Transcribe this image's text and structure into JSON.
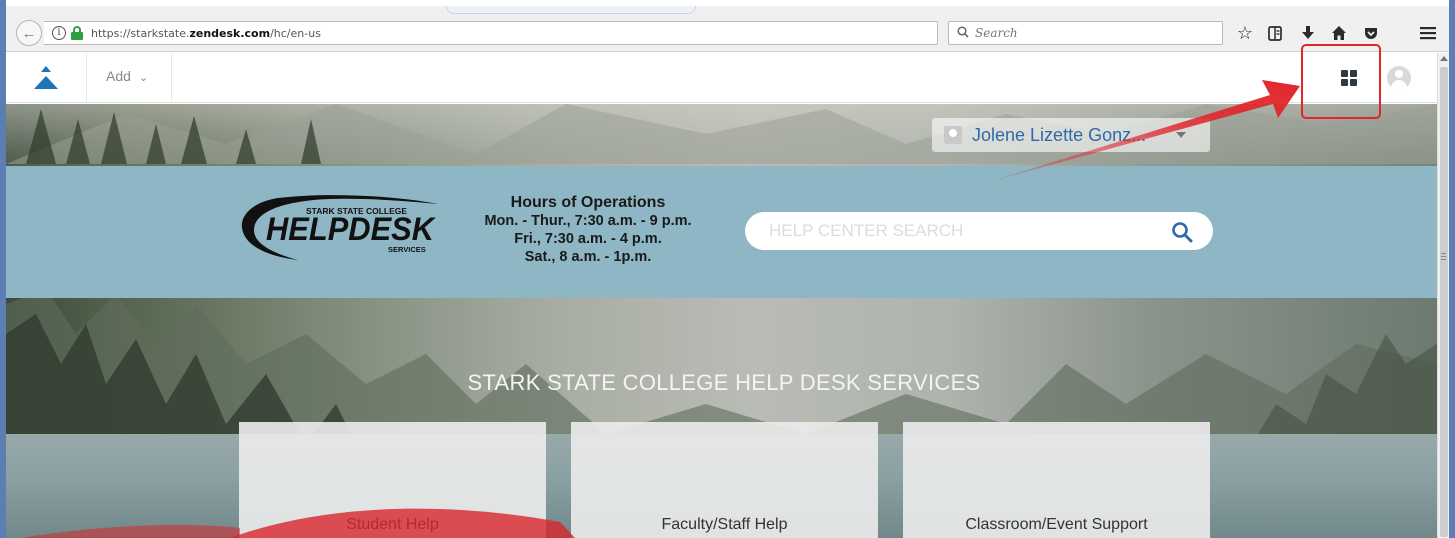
{
  "browser": {
    "url_prefix": "https://starkstate.",
    "url_domain": "zendesk.com",
    "url_path": "/hc/en-us",
    "search_placeholder": "Search",
    "icons": [
      "back-icon",
      "info-icon",
      "lock-icon",
      "reload-icon",
      "search-icon",
      "bookmark-star-icon",
      "reading-list-icon",
      "download-icon",
      "home-icon",
      "pocket-icon",
      "menu-icon"
    ]
  },
  "zendesk_bar": {
    "add_label": "Add",
    "icons": [
      "zendesk-logo-icon",
      "chevron-down-icon",
      "apps-grid-icon",
      "user-avatar-icon"
    ]
  },
  "page": {
    "user_name": "Jolene Lizette Gonz...",
    "logo_top_text": "STARK STATE COLLEGE",
    "logo_main_text": "HELPDESK",
    "logo_sub_text": "SERVICES",
    "hours": {
      "title": "Hours of Operations",
      "line1": "Mon. - Thur., 7:30 a.m. - 9 p.m.",
      "line2": "Fri., 7:30 a.m. - 4 p.m.",
      "line3": "Sat., 8 a.m. - 1p.m."
    },
    "search_placeholder": "HELP CENTER SEARCH",
    "hero_title": "STARK STATE COLLEGE HELP DESK SERVICES",
    "cards": [
      {
        "label": "Student Help"
      },
      {
        "label": "Faculty/Staff Help"
      },
      {
        "label": "Classroom/Event Support"
      }
    ]
  },
  "annotation": {
    "color": "#e0252b"
  }
}
